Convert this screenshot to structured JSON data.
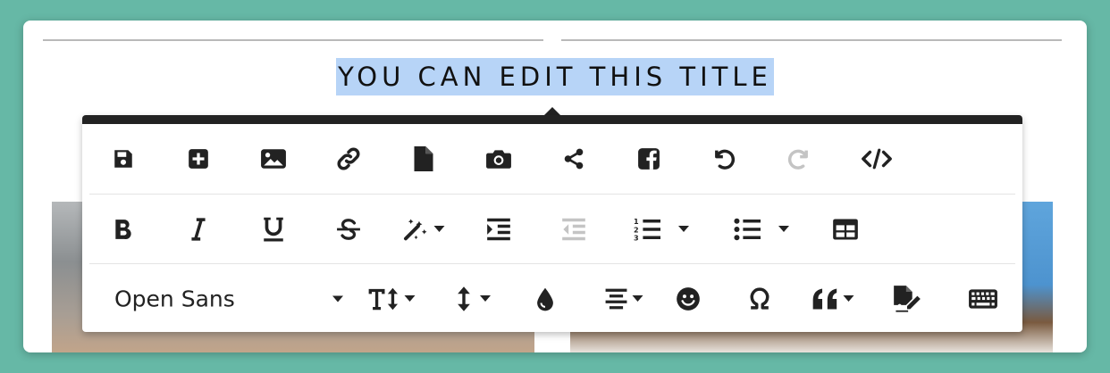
{
  "page": {
    "title": "YOU CAN EDIT THIS TITLE"
  },
  "toolbar": {
    "row1": [
      "save-icon",
      "add-icon",
      "image-icon",
      "link-icon",
      "file-icon",
      "camera-icon",
      "share-icon",
      "facebook-icon",
      "undo-icon",
      "redo-icon",
      "code-icon"
    ],
    "row2": [
      "bold-icon",
      "italic-icon",
      "underline-icon",
      "strikethrough-icon",
      "magic-icon",
      "indent-icon",
      "outdent-icon",
      "ordered-list-icon",
      "unordered-list-icon",
      "table-icon"
    ],
    "row3": [
      "font-size-icon",
      "line-height-icon",
      "color-icon",
      "align-icon",
      "emoji-icon",
      "omega-icon",
      "quote-icon",
      "signature-icon",
      "keyboard-icon"
    ],
    "font_family": "Open Sans",
    "redo_disabled": true,
    "outdent_disabled": true
  },
  "colors": {
    "background": "#66b8a6",
    "selection": "#b7d4f7",
    "icon": "#222222",
    "disabled_icon": "#c4c4c4"
  }
}
